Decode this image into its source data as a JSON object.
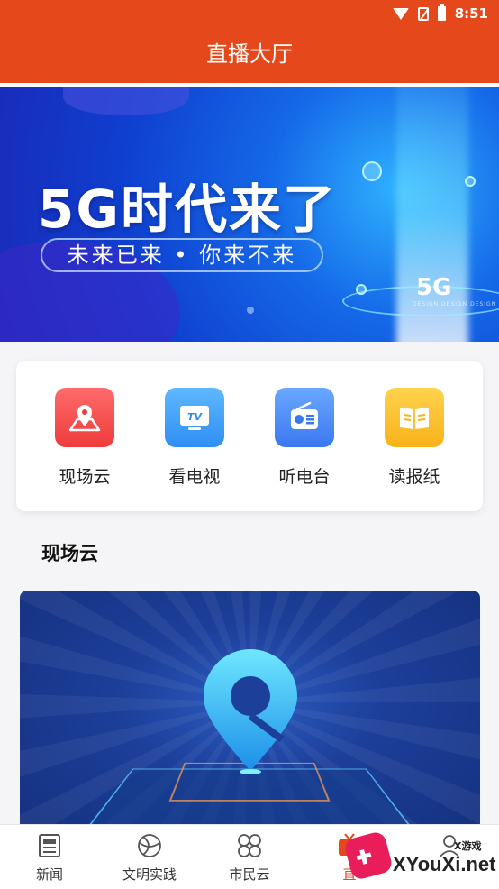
{
  "status_bar": {
    "time": "8:51",
    "icons": [
      "wifi-icon",
      "no-sim-icon",
      "battery-icon"
    ]
  },
  "header": {
    "title": "直播大厅",
    "color": "#e4481b"
  },
  "banner": {
    "headline": "5G时代来了",
    "subtitle": "未来已来 • 你来不来",
    "badge": "5G",
    "small_text": "DESIGN DESIGN DESIGN"
  },
  "quick_actions": [
    {
      "label": "现场云",
      "icon": "location-map-icon",
      "color": "#ee3b3b"
    },
    {
      "label": "看电视",
      "icon": "tv-icon",
      "color": "#2f8ef3"
    },
    {
      "label": "听电台",
      "icon": "radio-icon",
      "color": "#3b78f0"
    },
    {
      "label": "读报纸",
      "icon": "newspaper-book-icon",
      "color": "#f8b21a"
    }
  ],
  "section": {
    "title": "现场云"
  },
  "bottom_nav": [
    {
      "label": "新闻",
      "icon": "newspaper-icon",
      "active": false
    },
    {
      "label": "文明实践",
      "icon": "sphere-icon",
      "active": false
    },
    {
      "label": "市民云",
      "icon": "clover-icon",
      "active": false
    },
    {
      "label": "直",
      "icon": "live-tv-icon",
      "active": true
    },
    {
      "label": "",
      "icon": "user-icon",
      "active": false
    }
  ],
  "watermark": {
    "text": "XYouXi.net",
    "small": "X游戏"
  }
}
